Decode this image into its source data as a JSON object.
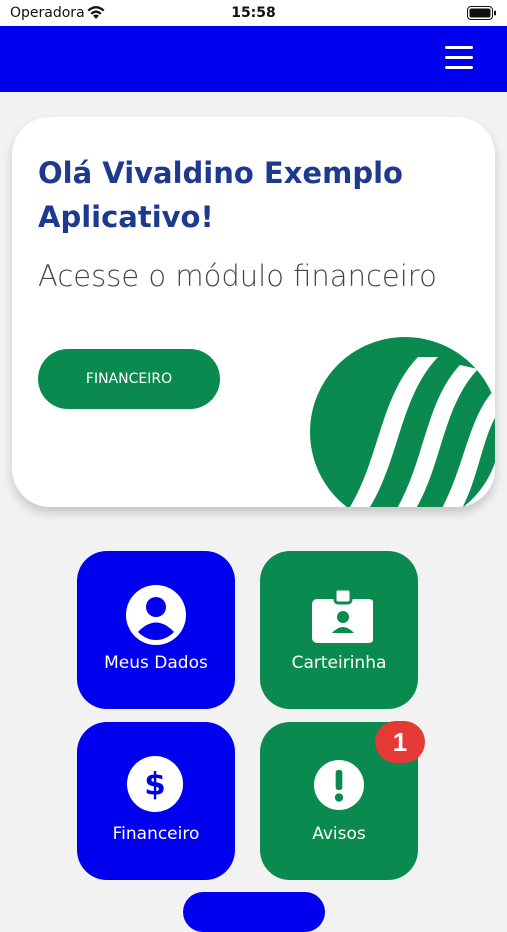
{
  "status_bar": {
    "carrier": "Operadora",
    "time": "15:58"
  },
  "card": {
    "greeting": "Olá Vivaldino Exemplo Aplicativo!",
    "subtitle": "Acesse o módulo financeiro",
    "button_label": "FINANCEIRO"
  },
  "tiles": [
    {
      "label": "Meus Dados",
      "icon": "user-icon"
    },
    {
      "label": "Carteirinha",
      "icon": "id-badge-icon"
    },
    {
      "label": "Financeiro",
      "icon": "dollar-icon"
    },
    {
      "label": "Avisos",
      "icon": "exclamation-icon",
      "badge": "1"
    }
  ],
  "colors": {
    "blue": "#0000ee",
    "green": "#0b8a4f",
    "title": "#1e3a8f",
    "badge": "#e53935"
  }
}
